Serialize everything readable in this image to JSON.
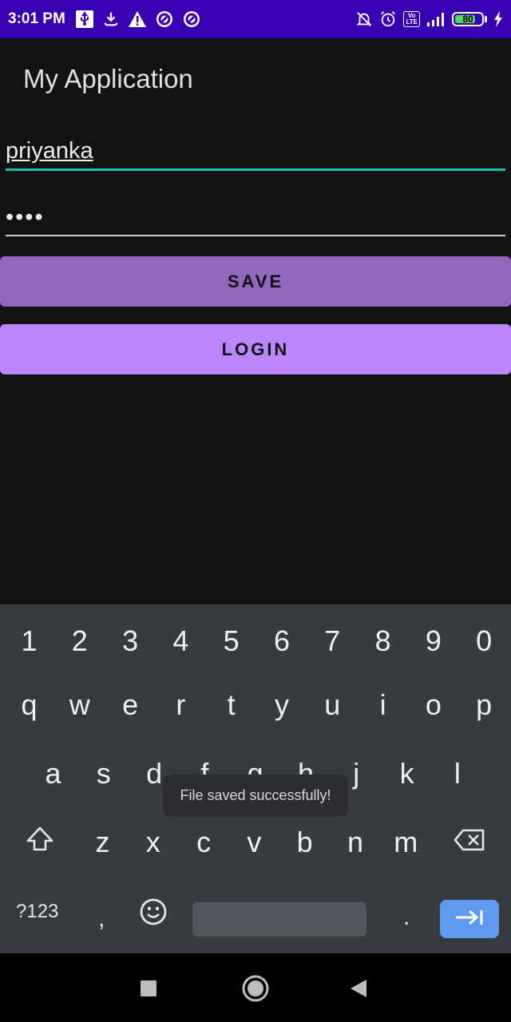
{
  "status_bar": {
    "time": "3:01 PM",
    "left_icons": [
      "usb-icon",
      "download-icon",
      "warning-icon",
      "app-icon",
      "app-icon"
    ],
    "right_icons": [
      "muted-bell-icon",
      "alarm-icon",
      "volte-icon",
      "signal-icon",
      "battery-icon",
      "charging-icon"
    ],
    "volte_top": "Vo",
    "volte_bottom": "LTE",
    "battery": "80",
    "battery_level": 0.8,
    "background_color": "#3700b3"
  },
  "app": {
    "title": "My Application",
    "background_color": "#121212"
  },
  "form": {
    "username_value": "priyanka",
    "password_value": "••••",
    "save_label": "SAVE",
    "login_label": "LOGIN",
    "save_color": "#8f67bc",
    "login_color": "#bb86fc",
    "focus_underline_color": "#1fbfae"
  },
  "keyboard": {
    "number_row": [
      "1",
      "2",
      "3",
      "4",
      "5",
      "6",
      "7",
      "8",
      "9",
      "0"
    ],
    "row1": [
      "q",
      "w",
      "e",
      "r",
      "t",
      "y",
      "u",
      "i",
      "o",
      "p"
    ],
    "row2": [
      "a",
      "s",
      "d",
      "f",
      "g",
      "h",
      "j",
      "k",
      "l"
    ],
    "row3": [
      "z",
      "x",
      "c",
      "v",
      "b",
      "n",
      "m"
    ],
    "symbols_label": "?123",
    "comma_label": ",",
    "period_label": ".",
    "shift_icon": "shift-icon",
    "backspace_icon": "backspace-icon",
    "emoji_icon": "emoji-icon",
    "enter_icon": "tab-arrow-icon",
    "enter_color": "#5e9bf0"
  },
  "toast": {
    "message": "File saved successfully!"
  },
  "nav_bar": {
    "items": [
      "recents-icon",
      "home-icon",
      "back-icon"
    ]
  }
}
